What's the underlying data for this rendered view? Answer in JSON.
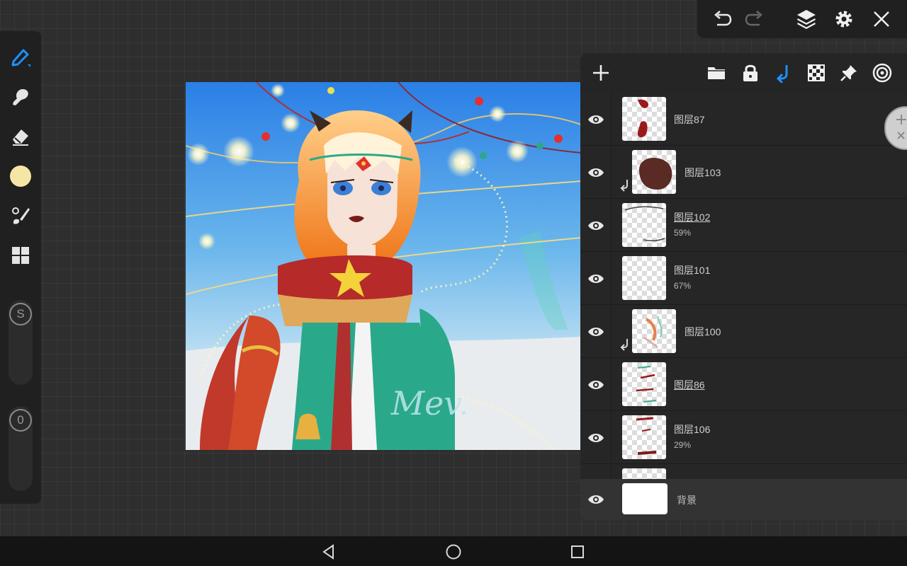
{
  "app": {
    "accent_color": "#1e90ff",
    "current_color": "#f6e6a6"
  },
  "toolbar": {
    "tools": [
      {
        "icon": "brush-pen-icon",
        "active": true
      },
      {
        "icon": "smudge-icon"
      },
      {
        "icon": "eraser-icon"
      },
      {
        "icon": "color-swatch-icon"
      },
      {
        "icon": "filter-brush-icon"
      },
      {
        "icon": "gallery-grid-icon"
      }
    ],
    "size_slider": {
      "label": "S"
    },
    "opacity_slider": {
      "label": "0"
    }
  },
  "top_bar": {
    "buttons": [
      "undo-icon",
      "redo-icon",
      "layers-icon",
      "settings-icon",
      "close-icon"
    ]
  },
  "canvas": {
    "signature_text": "Mev."
  },
  "layers_panel": {
    "toolbar_buttons": [
      "add-layer-icon",
      "folder-icon",
      "lock-icon",
      "clip-arrow-icon",
      "transparency-grid-icon",
      "pin-icon",
      "blend-target-icon"
    ],
    "layers": [
      {
        "name": "图层87",
        "opacity": "",
        "clipped": false,
        "underlined": false
      },
      {
        "name": "图层103",
        "opacity": "",
        "clipped": true,
        "underlined": false
      },
      {
        "name": "图层102",
        "opacity": "59%",
        "clipped": false,
        "underlined": true
      },
      {
        "name": "图层101",
        "opacity": "67%",
        "clipped": false,
        "underlined": false
      },
      {
        "name": "图层100",
        "opacity": "",
        "clipped": true,
        "underlined": false
      },
      {
        "name": "图层86",
        "opacity": "",
        "clipped": false,
        "underlined": true
      },
      {
        "name": "图层106",
        "opacity": "29%",
        "clipped": false,
        "underlined": false
      }
    ],
    "background_layer": {
      "name": "背景"
    }
  },
  "nav_bar": {
    "buttons": [
      "back-icon",
      "home-icon",
      "recents-icon"
    ]
  }
}
